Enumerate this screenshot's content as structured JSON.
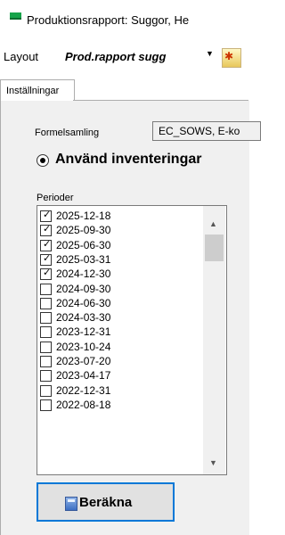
{
  "window": {
    "title": "Produktionsrapport: Suggor, He"
  },
  "toolbar": {
    "layout_label": "Layout",
    "layout_value": "Prod.rapport sugg",
    "dropdown_arrow": "▼"
  },
  "tabs": [
    {
      "label": "Inställningar",
      "active": true
    }
  ],
  "settings": {
    "formel_label": "Formelsamling",
    "formel_value": "EC_SOWS, E-ko",
    "radio_label": "Använd inventeringar",
    "perioder_label": "Perioder",
    "periods": [
      {
        "label": "2025-12-18",
        "checked": true
      },
      {
        "label": "2025-09-30",
        "checked": true
      },
      {
        "label": "2025-06-30",
        "checked": true
      },
      {
        "label": "2025-03-31",
        "checked": true
      },
      {
        "label": "2024-12-30",
        "checked": true
      },
      {
        "label": "2024-09-30",
        "checked": false
      },
      {
        "label": "2024-06-30",
        "checked": false
      },
      {
        "label": "2024-03-30",
        "checked": false
      },
      {
        "label": "2023-12-31",
        "checked": false
      },
      {
        "label": "2023-10-24",
        "checked": false
      },
      {
        "label": "2023-07-20",
        "checked": false
      },
      {
        "label": "2023-04-17",
        "checked": false
      },
      {
        "label": "2022-12-31",
        "checked": false
      },
      {
        "label": "2022-08-18",
        "checked": false
      }
    ],
    "check_glyph": "✓",
    "scroll_up": "▲",
    "scroll_down": "▼",
    "calc_label": "Beräkna"
  }
}
